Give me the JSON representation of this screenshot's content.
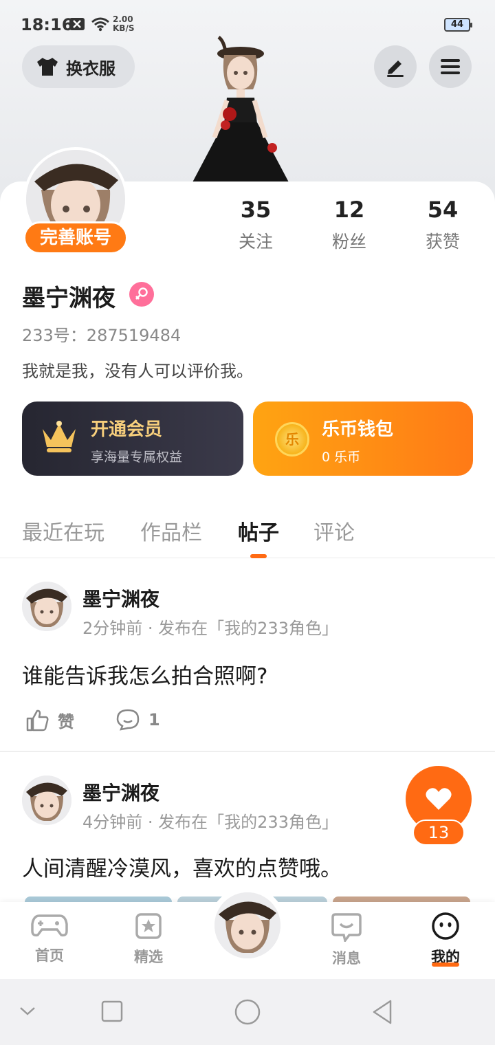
{
  "status_bar": {
    "time": "18:16",
    "net_speed": "2.00",
    "net_unit": "KB/S",
    "battery": "44"
  },
  "header": {
    "dress_label": "换衣服"
  },
  "profile": {
    "complete_badge": "完善账号",
    "stats": [
      {
        "value": "35",
        "label": "关注"
      },
      {
        "value": "12",
        "label": "粉丝"
      },
      {
        "value": "54",
        "label": "获赞"
      }
    ],
    "name": "墨宁渊夜",
    "uid": "233号：287519484",
    "bio": "我就是我，没有人可以评价我。"
  },
  "cards": {
    "vip": {
      "title": "开通会员",
      "subtitle": "享海量专属权益"
    },
    "wallet": {
      "title": "乐币钱包",
      "subtitle": "0 乐币",
      "coin_char": "乐"
    }
  },
  "tabs": [
    "最近在玩",
    "作品栏",
    "帖子",
    "评论"
  ],
  "active_tab": "帖子",
  "posts": [
    {
      "author": "墨宁渊夜",
      "meta": "2分钟前 · 发布在「我的233角色」",
      "text": "谁能告诉我怎么拍合照啊?",
      "like_label": "赞",
      "comment_count": "1"
    },
    {
      "author": "墨宁渊夜",
      "meta": "4分钟前 · 发布在「我的233角色」",
      "text": "人间清醒冷漠风，喜欢的点赞哦。",
      "like_count": "13"
    }
  ],
  "bottom_nav": [
    {
      "label": "首页",
      "icon": "gamepad-icon"
    },
    {
      "label": "精选",
      "icon": "star-box-icon"
    },
    {
      "label": "消息",
      "icon": "message-icon"
    },
    {
      "label": "我的",
      "icon": "face-icon"
    }
  ],
  "colors": {
    "accent": "#ff6a13",
    "vip_gold": "#f7cf7c",
    "female": "#ff6f9a"
  }
}
